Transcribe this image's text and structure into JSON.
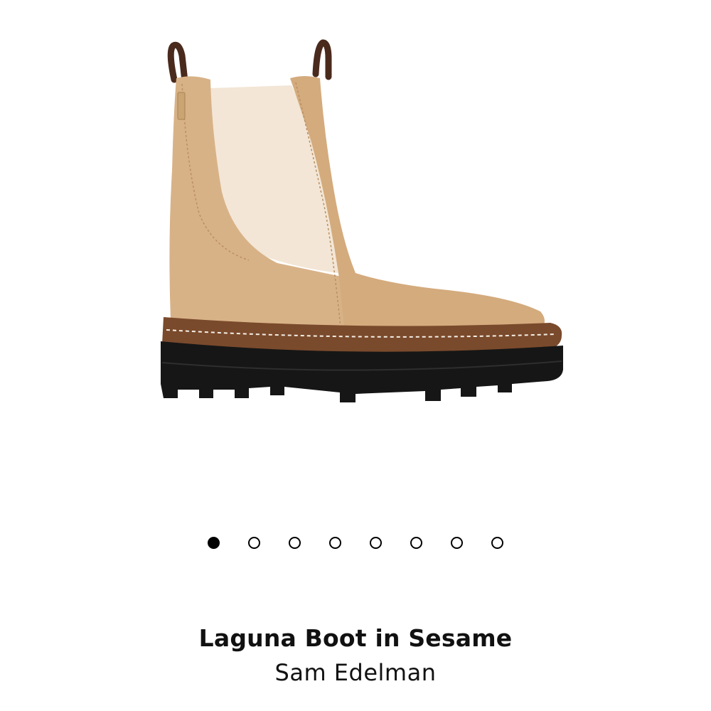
{
  "product": {
    "title": "Laguna Boot in Sesame",
    "brand": "Sam Edelman",
    "image_alt": "Tan leather chelsea boot with cream elastic side panel and black lug sole"
  },
  "carousel": {
    "total": 8,
    "active_index": 0
  },
  "colors": {
    "leather": "#d8b287",
    "elastic": "#f3e6d6",
    "sole": "#161616",
    "welt": "#7a4a2c",
    "pull_tab": "#4a2a1c",
    "active_dot": "#000000"
  }
}
